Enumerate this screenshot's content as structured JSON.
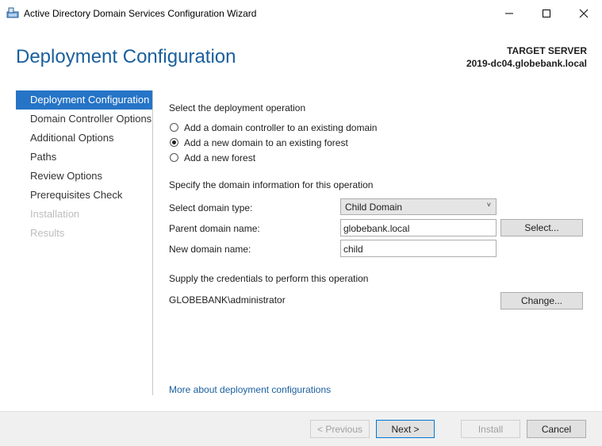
{
  "window": {
    "title": "Active Directory Domain Services Configuration Wizard",
    "icon": "server-wizard-icon"
  },
  "header": {
    "page_title": "Deployment Configuration",
    "target_label": "TARGET SERVER",
    "target_name": "2019-dc04.globebank.local"
  },
  "nav": {
    "items": [
      {
        "label": "Deployment Configuration",
        "state": "active"
      },
      {
        "label": "Domain Controller Options",
        "state": "normal"
      },
      {
        "label": "Additional Options",
        "state": "normal"
      },
      {
        "label": "Paths",
        "state": "normal"
      },
      {
        "label": "Review Options",
        "state": "normal"
      },
      {
        "label": "Prerequisites Check",
        "state": "normal"
      },
      {
        "label": "Installation",
        "state": "disabled"
      },
      {
        "label": "Results",
        "state": "disabled"
      }
    ]
  },
  "main": {
    "operation_heading": "Select the deployment operation",
    "operations": [
      {
        "label": "Add a domain controller to an existing domain",
        "checked": false
      },
      {
        "label": "Add a new domain to an existing forest",
        "checked": true
      },
      {
        "label": "Add a new forest",
        "checked": false
      }
    ],
    "domain_heading": "Specify the domain information for this operation",
    "domain_type_label": "Select domain type:",
    "domain_type_value": "Child Domain",
    "parent_label": "Parent domain name:",
    "parent_value": "globebank.local",
    "select_button": "Select...",
    "new_domain_label": "New domain name:",
    "new_domain_value": "child",
    "credentials_heading": "Supply the credentials to perform this operation",
    "credentials_value": "GLOBEBANK\\administrator",
    "change_button": "Change...",
    "more_link": "More about deployment configurations"
  },
  "footer": {
    "previous": "< Previous",
    "next": "Next >",
    "install": "Install",
    "cancel": "Cancel"
  },
  "colors": {
    "accent": "#2674c7",
    "title_blue": "#1a5f9e"
  }
}
